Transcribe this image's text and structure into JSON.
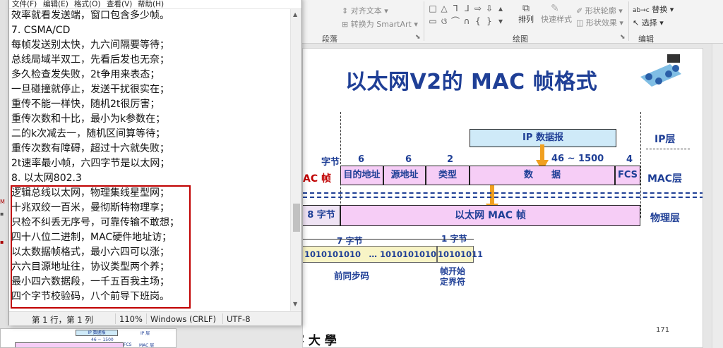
{
  "notepad": {
    "menu": [
      "文件(F)",
      "编辑(E)",
      "格式(O)",
      "查看(V)",
      "帮助(H)"
    ],
    "lines": [
      "效率就看发送端，窗口包含多少帧。",
      "7. CSMA/CD",
      "每帧发送别太快，九六间隔要等待；",
      "总线局域半双工，先看后发也无奈；",
      "多久检查发失败，2t争用来表态；",
      "一旦碰撞就停止，发送干扰很实在；",
      "重传不能一样快，随机2t很厉害；",
      "重传次数和十比，最小为k参数在；",
      "二的k次减去一，随机区间算等待；",
      "重传次数有障碍，超过十六就失败；",
      "2t速率最小帧，六四字节是以太网；",
      "8. 以太网802.3",
      "逻辑总线以太网，物理集线星型网；",
      "十兆双绞一百米，曼彻斯特物理享；",
      "只检不纠丢无序号，可靠传输不敢想；",
      "四十八位二进制，MAC硬件地址访；",
      "以太数据帧格式，最小六四可以涨；",
      "六六目源地址往，协议类型两个养；",
      "最小四六数据段，一千五百我主场；",
      "四个字节校验码，八个前导下班岗。"
    ],
    "status": {
      "position": "第 1 行，第 1 列",
      "zoom": "110%",
      "line_ending": "Windows (CRLF)",
      "encoding": "UTF-8"
    }
  },
  "ribbon": {
    "align_text": "对齐文本",
    "convert_smartart": "转换为 SmartArt",
    "paragraph_group": "段落",
    "arrange": "排列",
    "quick_styles": "快速样式",
    "shape_outline": "形状轮廓",
    "shape_effects": "形状效果",
    "drawing_group": "绘图",
    "replace": "替换",
    "select": "选择",
    "editing_group": "编辑"
  },
  "slide": {
    "title": "以太网V2的 MAC 帧格式",
    "ip_datagram": "IP 数据报",
    "ip_layer": "IP层",
    "mac_layer": "MAC层",
    "physical_layer": "物理层",
    "bytes_label": "字节",
    "mac_frame_partial": "AC 帧",
    "field_sizes": [
      "6",
      "6",
      "2",
      "46 ~ 1500",
      "4"
    ],
    "fields": [
      "目的地址",
      "源地址",
      "类型",
      "数　　据",
      "FCS"
    ],
    "eight_bytes": "8 字节",
    "ethernet_mac_frame": "以太网 MAC 帧",
    "seven_bytes": "7 字节",
    "one_byte": "1 字节",
    "preamble_bits": "1010101010　… 1010101010",
    "sfd_bits": "10101011",
    "preamble_label": "前同步码",
    "sfd_label_1": "帧开始",
    "sfd_label_2": "定界符",
    "page_number": "171",
    "university": "邃 寧 大 學"
  },
  "thumbnail": {
    "ip_datagram": "IP 数据报",
    "ip_layer": "IP 层",
    "range": "46 ~ 1500",
    "fcs": "FCS",
    "mac_layer": "MAC 层"
  },
  "colors": {
    "title_blue": "#1f3f96",
    "highlight_red": "#c00000",
    "field_pink": "#f6cdf6",
    "ip_box_blue": "#cfeaf8",
    "arrow_orange": "#f0a020"
  }
}
